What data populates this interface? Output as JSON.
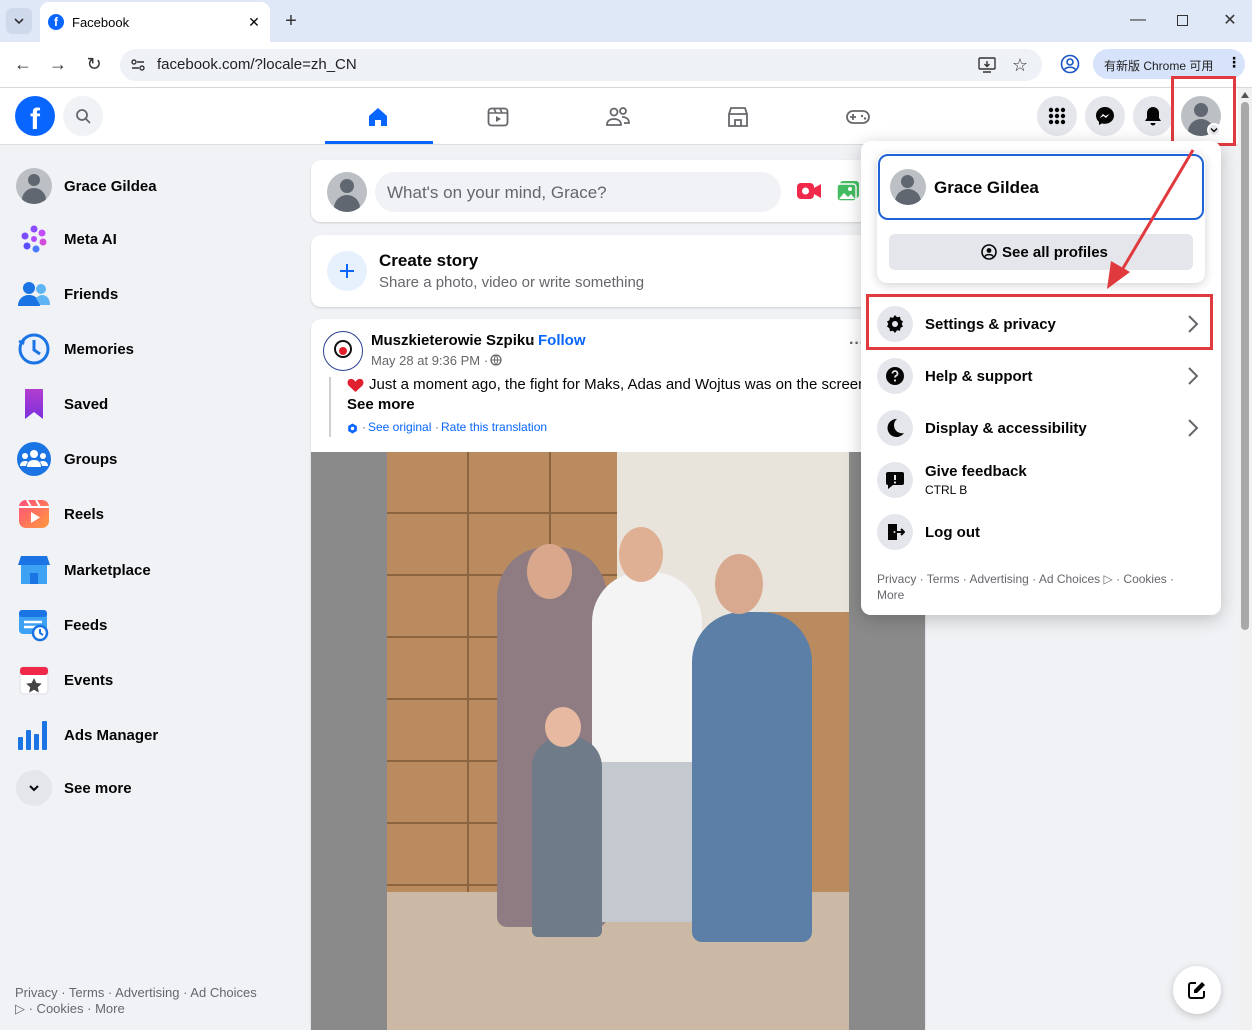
{
  "browser": {
    "tab_title": "Facebook",
    "url": "facebook.com/?locale=zh_CN",
    "update_label": "有新版 Chrome 可用"
  },
  "header": {
    "nav_tabs": [
      "home",
      "video",
      "friends",
      "marketplace",
      "gaming"
    ],
    "active_tab": "home"
  },
  "sidebar": {
    "items": [
      {
        "label": "Grace Gildea",
        "icon": "avatar"
      },
      {
        "label": "Meta AI",
        "icon": "meta-ai-icon"
      },
      {
        "label": "Friends",
        "icon": "friends-icon"
      },
      {
        "label": "Memories",
        "icon": "memories-icon"
      },
      {
        "label": "Saved",
        "icon": "saved-icon"
      },
      {
        "label": "Groups",
        "icon": "groups-icon"
      },
      {
        "label": "Reels",
        "icon": "reels-icon"
      },
      {
        "label": "Marketplace",
        "icon": "marketplace-icon"
      },
      {
        "label": "Feeds",
        "icon": "feeds-icon"
      },
      {
        "label": "Events",
        "icon": "events-icon"
      },
      {
        "label": "Ads Manager",
        "icon": "ads-manager-icon"
      },
      {
        "label": "See more",
        "icon": "chevron-down-icon"
      }
    ],
    "footer_line1": "Privacy · Terms · Advertising · Ad Choices",
    "footer_line2": "▷ · Cookies · More"
  },
  "composer": {
    "placeholder": "What's on your mind, Grace?"
  },
  "story": {
    "title": "Create story",
    "subtitle": "Share a photo, video or write something"
  },
  "post": {
    "author": "Muszkieterowie Szpiku",
    "follow": "Follow",
    "sep": "·",
    "time": "May 28 at 9:36 PM · ",
    "text": "Just a moment ago, the fight for Maks, Adas and Wojtus was on the screen",
    "see_more": "See more",
    "see_original": "See original",
    "rate_translation": "Rate this translation",
    "more_icon": "···"
  },
  "menu": {
    "profile_name": "Grace Gildea",
    "see_all_profiles": "See all profiles",
    "items": [
      {
        "label": "Settings & privacy",
        "icon": "gear-icon"
      },
      {
        "label": "Help & support",
        "icon": "question-icon"
      },
      {
        "label": "Display & accessibility",
        "icon": "moon-icon"
      },
      {
        "label": "Give feedback",
        "sub": "CTRL B",
        "icon": "feedback-icon"
      },
      {
        "label": "Log out",
        "icon": "logout-icon"
      }
    ],
    "footer_line1": "Privacy · Terms · Advertising · Ad Choices ▷ · Cookies ·",
    "footer_line2": "More"
  },
  "colors": {
    "brand": "#0866ff",
    "highlight": "#e03a3e"
  }
}
